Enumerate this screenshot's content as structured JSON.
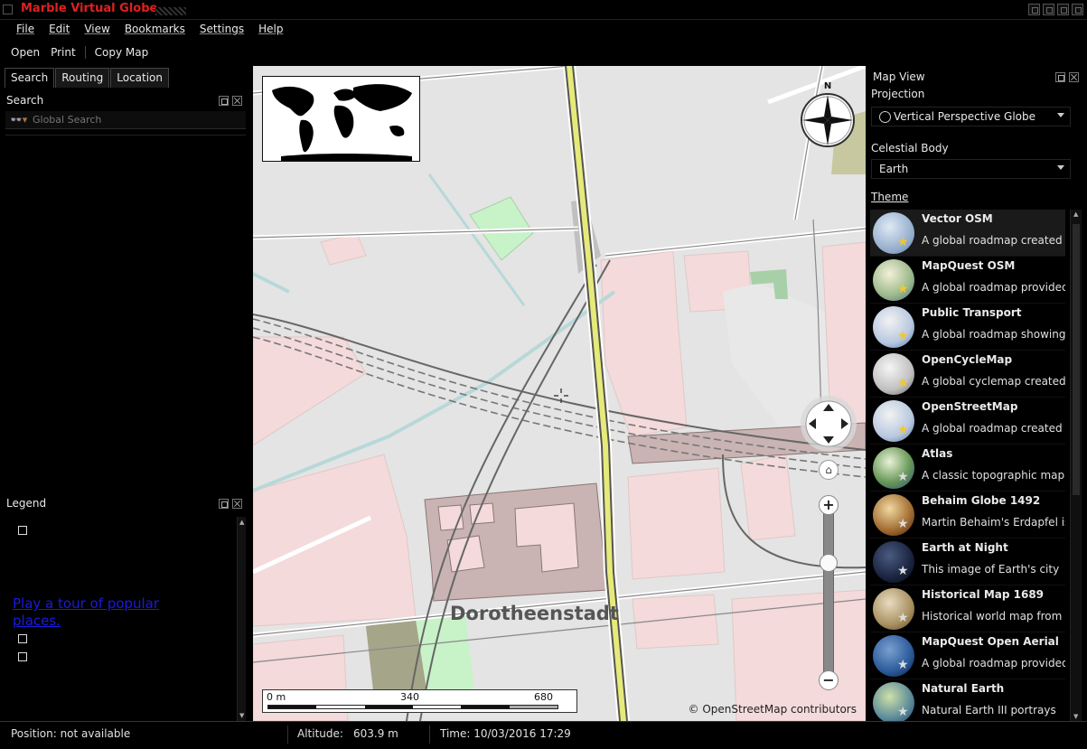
{
  "window": {
    "title": "Marble Virtual Globe"
  },
  "menu": [
    "File",
    "Edit",
    "View",
    "Bookmarks",
    "Settings",
    "Help"
  ],
  "toolbar": {
    "open": "Open",
    "print": "Print",
    "copy_map": "Copy Map"
  },
  "left_tabs": [
    "Search",
    "Routing",
    "Location"
  ],
  "search": {
    "title": "Search",
    "placeholder": "Global Search",
    "icon": "binoculars-icon"
  },
  "legend": {
    "title": "Legend",
    "tour_link": "Play a tour of popular places."
  },
  "map": {
    "district_label": "Dorotheenstadt",
    "compass_label": "N",
    "attribution": "© OpenStreetMap contributors",
    "scale": {
      "labels": [
        "0 m",
        "340",
        "680"
      ]
    },
    "zoom": {
      "plus": "+",
      "minus": "−",
      "level": 0.25
    }
  },
  "map_view": {
    "title": "Map View",
    "projection_label": "Projection",
    "projection_value": "Vertical Perspective Globe",
    "celestial_label": "Celestial Body",
    "celestial_value": "Earth",
    "theme_label": "Theme",
    "themes": [
      {
        "name": "Vector OSM",
        "desc": "A global roadmap created",
        "selected": true
      },
      {
        "name": "MapQuest OSM",
        "desc": "A global roadmap provided"
      },
      {
        "name": "Public Transport",
        "desc": "A global roadmap showing"
      },
      {
        "name": "OpenCycleMap",
        "desc": "A global cyclemap created"
      },
      {
        "name": "OpenStreetMap",
        "desc": "A global roadmap created"
      },
      {
        "name": "Atlas",
        "desc": "A classic topographic map."
      },
      {
        "name": "Behaim Globe 1492",
        "desc": "Martin Behaim's Erdapfel is"
      },
      {
        "name": "Earth at Night",
        "desc": "This image of Earth's city"
      },
      {
        "name": "Historical Map 1689",
        "desc": "Historical world map from"
      },
      {
        "name": "MapQuest Open Aerial",
        "desc": "A global roadmap provided"
      },
      {
        "name": "Natural Earth",
        "desc": "Natural Earth III portrays"
      }
    ]
  },
  "status": {
    "position": "Position: not available",
    "altitude_label": "Altitude:",
    "altitude_value": "603.9 m",
    "time": "Time: 10/03/2016 17:29"
  }
}
